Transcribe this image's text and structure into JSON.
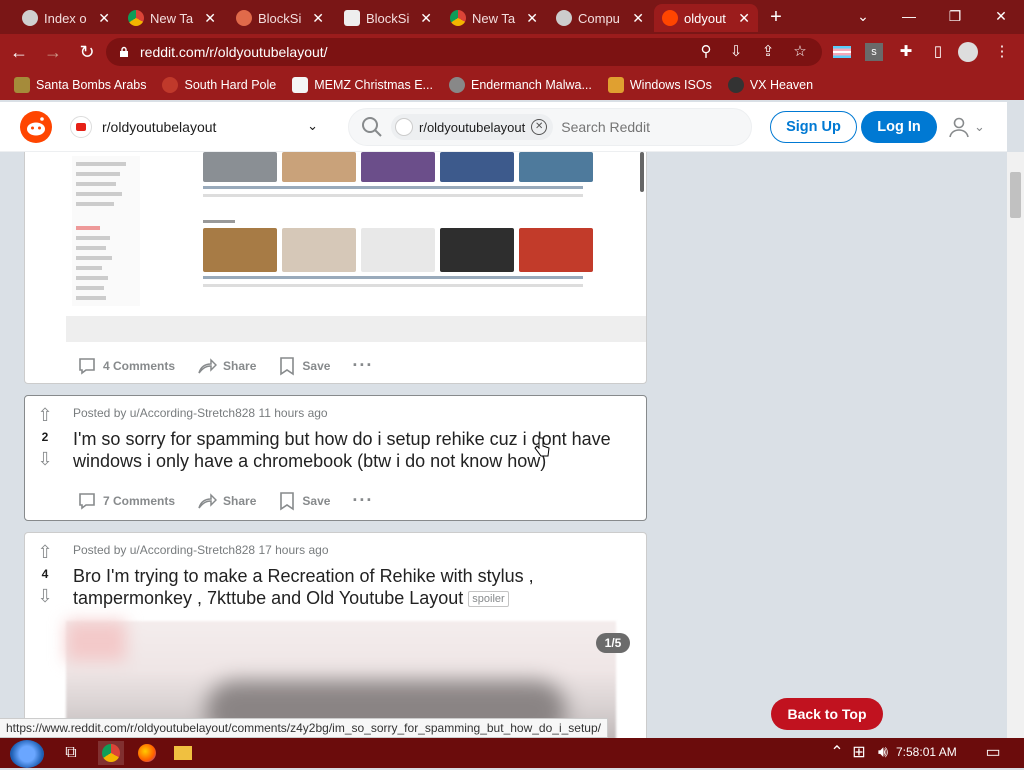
{
  "browser": {
    "tabs": [
      {
        "title": "Index o",
        "favicon_color": "#d0d0d0"
      },
      {
        "title": "New Ta",
        "favicon_color": "#4285f4"
      },
      {
        "title": "BlockSi",
        "favicon_color": "#e06a4a"
      },
      {
        "title": "BlockSi",
        "favicon_color": "#eeeeee"
      },
      {
        "title": "New Ta",
        "favicon_color": "#4285f4"
      },
      {
        "title": "Compu",
        "favicon_color": "#cccccc"
      },
      {
        "title": "oldyout",
        "favicon_color": "#ff4500"
      }
    ],
    "close_glyph": "✕",
    "new_tab_glyph": "+",
    "url": "reddit.com/r/oldyoutubelayout/",
    "bookmarks": [
      {
        "label": "Santa Bombs Arabs",
        "color": "#a58b3a"
      },
      {
        "label": "South Hard Pole",
        "color": "#c0392b"
      },
      {
        "label": "MEMZ Christmas E...",
        "color": "#f4f4f4"
      },
      {
        "label": "Endermanch Malwa...",
        "color": "#888888"
      },
      {
        "label": "Windows ISOs",
        "color": "#e0a030"
      },
      {
        "label": "VX Heaven",
        "color": "#333333"
      }
    ]
  },
  "reddit": {
    "subreddit": "r/oldyoutubelayout",
    "search_chip": "r/oldyoutubelayout",
    "search_placeholder": "Search Reddit",
    "signup_label": "Sign Up",
    "login_label": "Log In",
    "accent": "#0079d3",
    "posts": [
      {
        "comments": "4 Comments",
        "share": "Share",
        "save": "Save"
      },
      {
        "votes": "2",
        "meta": "Posted by u/According-Stretch828 11 hours ago",
        "title_line1": "I'm so sorry for spamming but how do i setup rehike cuz i dont have",
        "title_line2": "windows i only have a chromebook (btw i do not know how)",
        "comments": "7 Comments",
        "share": "Share",
        "save": "Save"
      },
      {
        "votes": "4",
        "meta": "Posted by u/According-Stretch828 17 hours ago",
        "title_line1": "Bro I'm trying to make a Recreation of Rehike with stylus ,",
        "title_line2": "tampermonkey , 7kttube and Old Youtube Layout",
        "flair": "spoiler",
        "gallery_counter": "1/5"
      }
    ],
    "back_to_top": "Back to Top"
  },
  "status_url": "https://www.reddit.com/r/oldyoutubelayout/comments/z4y2bg/im_so_sorry_for_spamming_but_how_do_i_setup/",
  "taskbar": {
    "time": "7:58:01 AM"
  }
}
